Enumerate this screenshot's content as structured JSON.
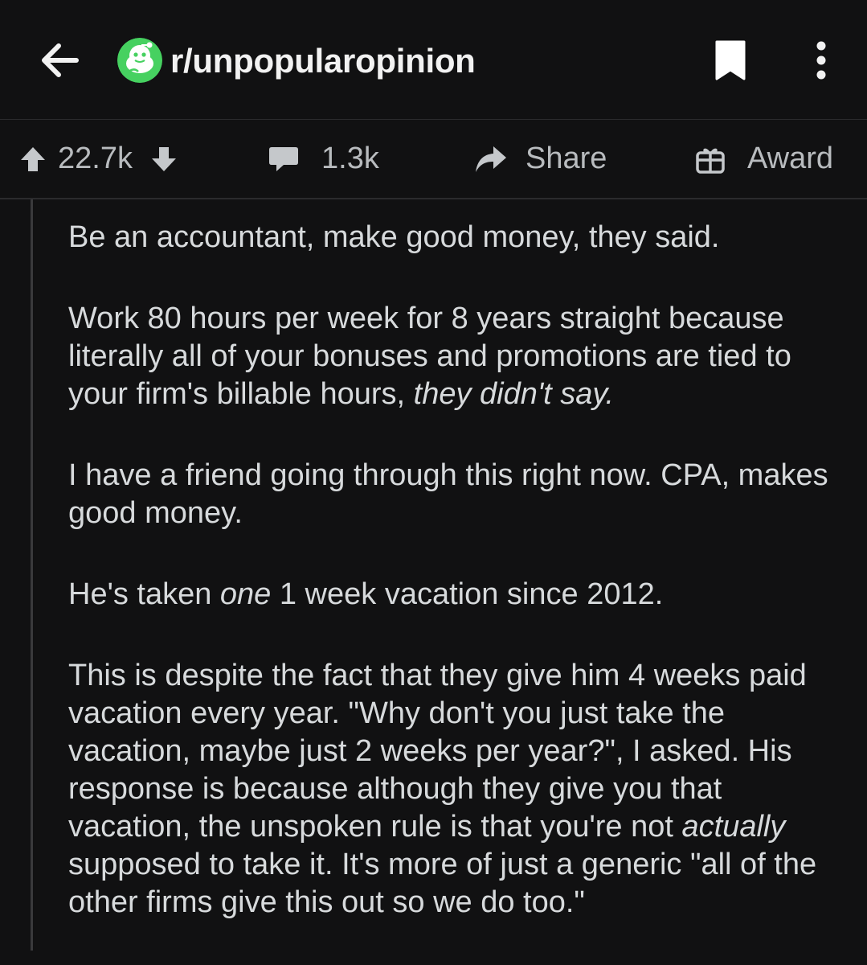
{
  "header": {
    "subreddit": "r/unpopularopinion",
    "back_icon": "arrow-left-icon",
    "bookmark_icon": "bookmark-icon",
    "overflow_icon": "more-vertical-icon"
  },
  "actions": {
    "score": "22.7k",
    "comments": "1.3k",
    "share_label": "Share",
    "award_label": "Award"
  },
  "comment": {
    "p1": "Be an accountant, make good money, they said.",
    "p2_text": "Work 80 hours per week for 8 years straight because literally all of your bonuses and promotions are tied to your firm's billable hours, ",
    "p2_italic": "they didn't say.",
    "p3": "I have a friend going through this right now. CPA, makes good money.",
    "p4_pre": "He's taken ",
    "p4_italic": "one",
    "p4_post": " 1 week vacation since 2012.",
    "p5_pre": "This is despite the fact that they give him 4 weeks paid vacation every year. \"Why don't you just take the vacation, maybe just 2 weeks per year?\", I asked. His response is because although they give you that vacation, the unspoken rule is that you're not ",
    "p5_italic": "actually",
    "p5_post": " supposed to take it. It's more of just a generic \"all of the other firms give this out so we do too.\""
  },
  "colors": {
    "background": "#111112",
    "text": "#d7dadc",
    "muted": "#b8bbbe",
    "divider": "#2b2b2d",
    "avatar_green": "#46d160"
  }
}
